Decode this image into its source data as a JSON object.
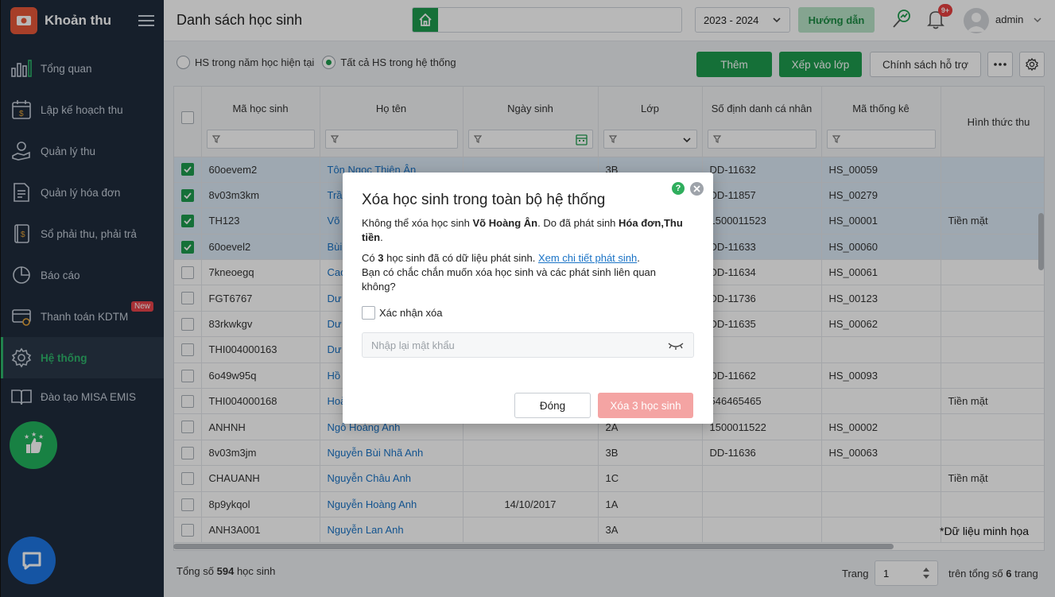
{
  "app": {
    "name": "Khoản thu",
    "page_title": "Danh sách học sinh"
  },
  "sidebar": {
    "items": [
      {
        "label": "Tổng quan",
        "icon": "bar-chart-icon"
      },
      {
        "label": "Lập kế hoạch thu",
        "icon": "calendar-money-icon"
      },
      {
        "label": "Quản lý thu",
        "icon": "hand-coin-icon"
      },
      {
        "label": "Quản lý hóa đơn",
        "icon": "invoice-icon"
      },
      {
        "label": "Sổ phải thu, phải trả",
        "icon": "ledger-icon"
      },
      {
        "label": "Báo cáo",
        "icon": "pie-chart-icon"
      },
      {
        "label": "Thanh toán KDTM",
        "icon": "card-payment-icon",
        "badge": "New"
      },
      {
        "label": "Hệ thống",
        "icon": "gear-icon",
        "active": true
      },
      {
        "label": "Đào tạo MISA EMIS",
        "icon": "book-icon"
      }
    ]
  },
  "header": {
    "school_year": "2023 - 2024",
    "guide_label": "Hướng dẫn",
    "notification_count": "9+",
    "user_name": "admin"
  },
  "toolbar": {
    "radio_current": "HS trong năm học hiện tại",
    "radio_all": "Tất cả HS trong hệ thống",
    "add_label": "Thêm",
    "assign_label": "Xếp vào lớp",
    "policy_label": "Chính sách hỗ trợ"
  },
  "table": {
    "columns": [
      "Mã học sinh",
      "Họ tên",
      "Ngày sinh",
      "Lớp",
      "Số định danh cá nhân",
      "Mã thống kê",
      "Hình thức thu"
    ],
    "rows": [
      {
        "selected": true,
        "code": "60oevem2",
        "name": "Tôn Ngọc Thiên Ân",
        "dob": "",
        "class": "3B",
        "id_no": "DD-11632",
        "stat": "HS_00059",
        "method": ""
      },
      {
        "selected": true,
        "code": "8v03m3km",
        "name": "Trần",
        "dob": "",
        "class": "",
        "id_no": "DD-11857",
        "stat": "HS_00279",
        "method": ""
      },
      {
        "selected": true,
        "code": "TH123",
        "name": "Võ",
        "dob": "",
        "class": "",
        "id_no": "1500011523",
        "stat": "HS_00001",
        "method": "Tiền mặt"
      },
      {
        "selected": true,
        "code": "60oevel2",
        "name": "Bùi",
        "dob": "",
        "class": "",
        "id_no": "DD-11633",
        "stat": "HS_00060",
        "method": ""
      },
      {
        "selected": false,
        "code": "7kneoegq",
        "name": "Cao",
        "dob": "",
        "class": "",
        "id_no": "DD-11634",
        "stat": "HS_00061",
        "method": ""
      },
      {
        "selected": false,
        "code": "FGT6767",
        "name": "Dư",
        "dob": "",
        "class": "",
        "id_no": "DD-11736",
        "stat": "HS_00123",
        "method": ""
      },
      {
        "selected": false,
        "code": "83rkwkgv",
        "name": "Dư",
        "dob": "",
        "class": "",
        "id_no": "DD-11635",
        "stat": "HS_00062",
        "method": ""
      },
      {
        "selected": false,
        "code": "THI004000163",
        "name": "Dư",
        "dob": "",
        "class": "",
        "id_no": "",
        "stat": "",
        "method": ""
      },
      {
        "selected": false,
        "code": "6o49w95q",
        "name": "Hồ",
        "dob": "",
        "class": "",
        "id_no": "DD-11662",
        "stat": "HS_00093",
        "method": ""
      },
      {
        "selected": false,
        "code": "THI004000168",
        "name": "Hoà",
        "dob": "",
        "class": "",
        "id_no": "546465465",
        "stat": "",
        "method": "Tiền mặt"
      },
      {
        "selected": false,
        "code": "ANHNH",
        "name": "Ngô Hoàng Anh",
        "dob": "",
        "class": "2A",
        "id_no": "1500011522",
        "stat": "HS_00002",
        "method": ""
      },
      {
        "selected": false,
        "code": "8v03m3jm",
        "name": "Nguyễn Bùi Nhã Anh",
        "dob": "",
        "class": "3B",
        "id_no": "DD-11636",
        "stat": "HS_00063",
        "method": ""
      },
      {
        "selected": false,
        "code": "CHAUANH",
        "name": "Nguyễn Châu Anh",
        "dob": "",
        "class": "1C",
        "id_no": "",
        "stat": "",
        "method": "Tiền mặt"
      },
      {
        "selected": false,
        "code": "8p9ykqol",
        "name": "Nguyễn Hoàng Anh",
        "dob": "14/10/2017",
        "class": "1A",
        "id_no": "",
        "stat": "",
        "method": ""
      },
      {
        "selected": false,
        "code": "ANH3A001",
        "name": "Nguyễn Lan Anh",
        "dob": "",
        "class": "3A",
        "id_no": "",
        "stat": "",
        "method": ""
      }
    ],
    "note": "*Dữ liệu minh họa"
  },
  "footer": {
    "total_prefix": "Tổng số",
    "total_count": "594",
    "total_suffix": "học sinh",
    "page_label": "Trang",
    "page_value": "1",
    "page_total_prefix": "trên tổng số",
    "page_total": "6",
    "page_total_suffix": "trang"
  },
  "dialog": {
    "title": "Xóa học sinh trong toàn bộ hệ thống",
    "line1_a": "Không thể xóa học sinh",
    "student_name": "Võ Hoàng Ân",
    "line1_b": ". Do đã phát sinh",
    "line1_c": "Hóa đơn,Thu tiền",
    "line1_end": ".",
    "line2_a": "Có",
    "count": "3",
    "line2_b": "học sinh đã có dữ liệu phát sinh.",
    "detail_link": "Xem chi tiết phát sinh",
    "line2_end": ".",
    "line3": "Bạn có chắc chắn muốn xóa học sinh và các phát sinh liên quan không?",
    "confirm_label": "Xác nhận xóa",
    "password_placeholder": "Nhập lại mật khẩu",
    "cancel_label": "Đóng",
    "delete_label": "Xóa 3 học sinh"
  },
  "colors": {
    "primary": "#1e9b4e",
    "sidebar": "#1f2b3c",
    "link": "#1a73c6",
    "danger_disabled": "#f4a4a3",
    "selected_row": "#dbe9f6"
  }
}
